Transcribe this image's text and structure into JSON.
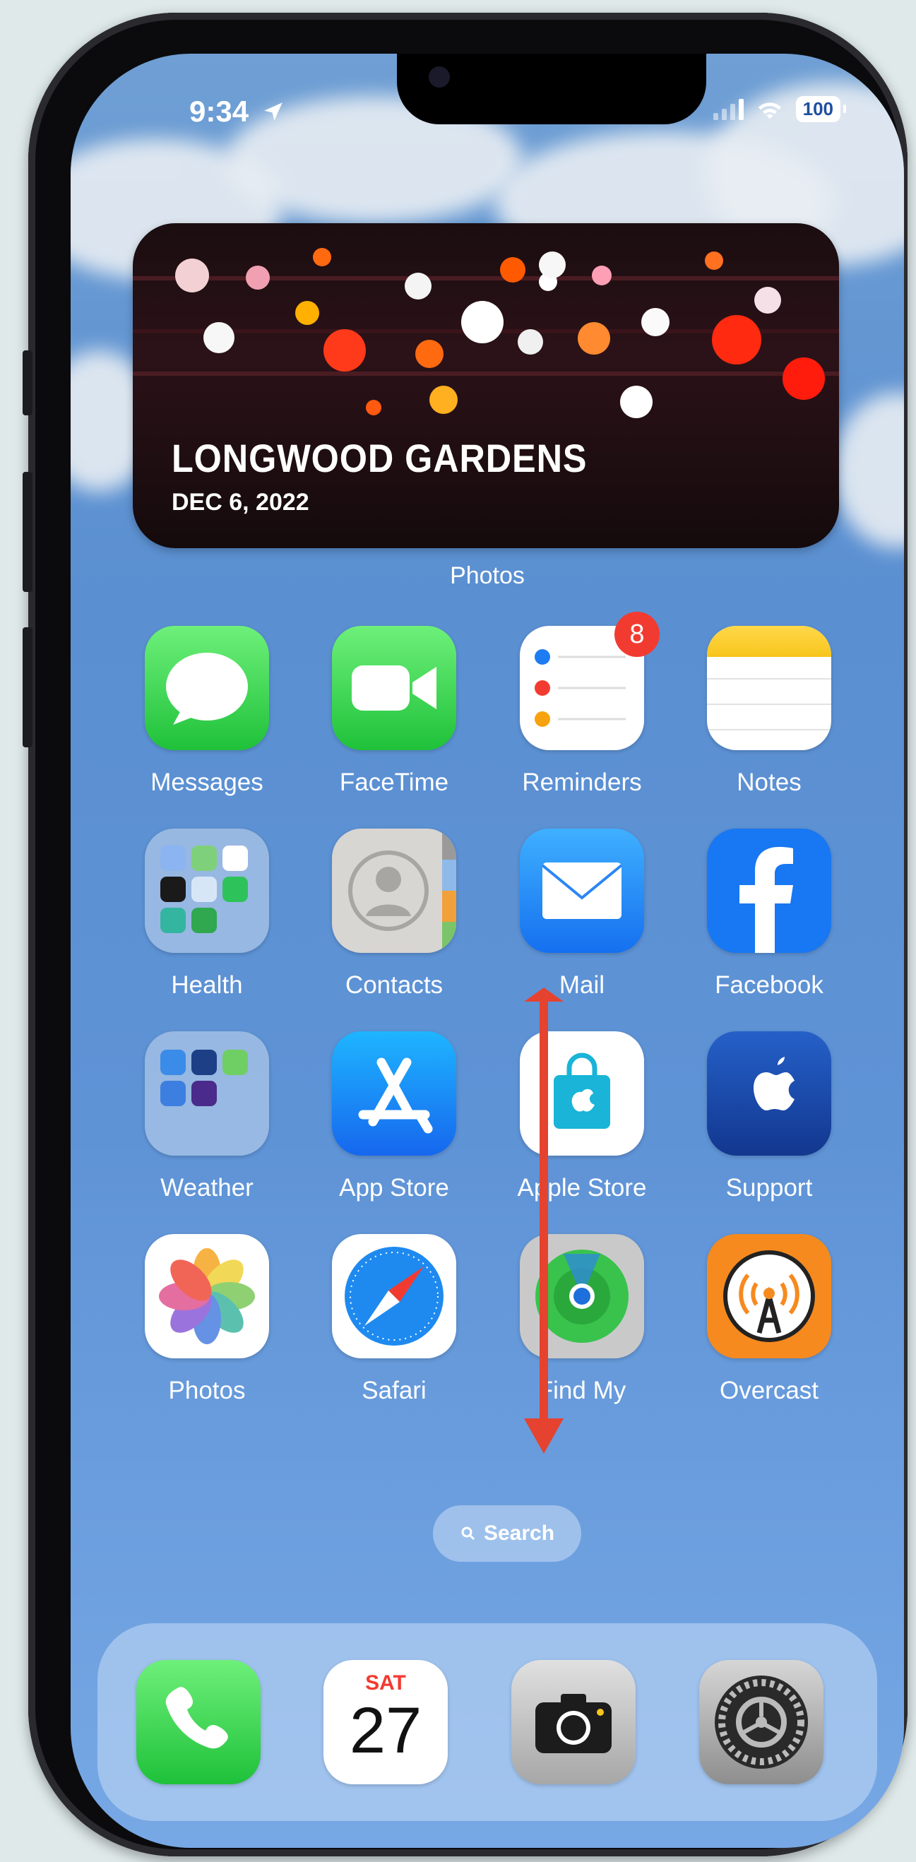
{
  "status_bar": {
    "time": "9:34",
    "battery": "100"
  },
  "widget": {
    "title": "LONGWOOD GARDENS",
    "date": "DEC 6, 2022",
    "label": "Photos"
  },
  "apps": {
    "messages": "Messages",
    "facetime": "FaceTime",
    "reminders": "Reminders",
    "reminders_badge": "8",
    "notes": "Notes",
    "health": "Health",
    "contacts": "Contacts",
    "mail": "Mail",
    "facebook": "Facebook",
    "weather": "Weather",
    "appstore": "App Store",
    "applestore": "Apple Store",
    "support": "Support",
    "photos": "Photos",
    "safari": "Safari",
    "findmy": "Find My",
    "overcast": "Overcast"
  },
  "search": {
    "label": "Search"
  },
  "dock": {
    "calendar_day": "SAT",
    "calendar_date": "27"
  },
  "colors": {
    "accent_arrow": "#e5432f",
    "badge": "#f23b30"
  },
  "icons": [
    "location-arrow-icon",
    "signal-icon",
    "wifi-icon",
    "battery-icon",
    "messages-icon",
    "facetime-icon",
    "reminders-icon",
    "notes-icon",
    "health-folder-icon",
    "contacts-icon",
    "mail-icon",
    "facebook-icon",
    "weather-folder-icon",
    "appstore-icon",
    "applestore-icon",
    "support-icon",
    "photos-icon",
    "safari-icon",
    "findmy-icon",
    "overcast-icon",
    "search-icon",
    "phone-icon",
    "calendar-icon",
    "camera-icon",
    "settings-icon"
  ]
}
